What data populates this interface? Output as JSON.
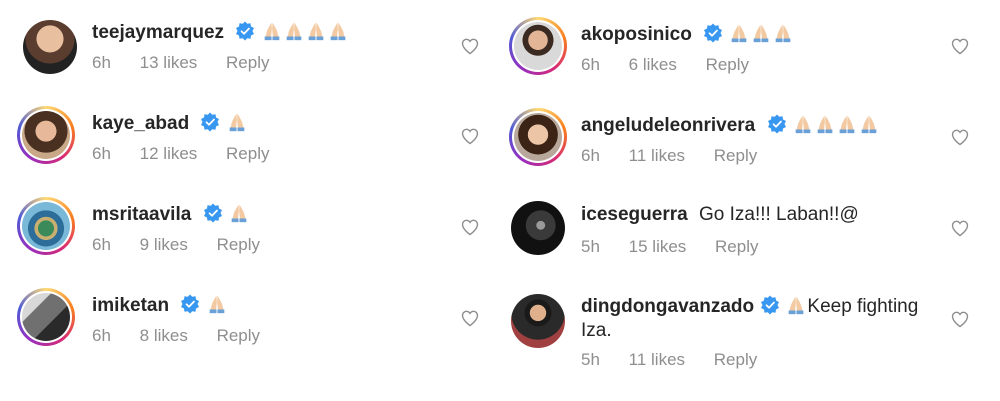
{
  "left_column": [
    {
      "username": "teejaymarquez",
      "text": "",
      "emoji_count": 4,
      "time": "6h",
      "likes": "13 likes",
      "reply": "Reply"
    },
    {
      "username": "kaye_abad",
      "text": "",
      "emoji_count": 1,
      "time": "6h",
      "likes": "12 likes",
      "reply": "Reply"
    },
    {
      "username": "msritaavila",
      "text": "",
      "emoji_count": 1,
      "time": "6h",
      "likes": "9 likes",
      "reply": "Reply"
    },
    {
      "username": "imiketan",
      "text": "",
      "emoji_count": 1,
      "time": "6h",
      "likes": "8 likes",
      "reply": "Reply"
    }
  ],
  "right_column": [
    {
      "username": "akoposinico",
      "text": "",
      "emoji_count": 3,
      "time": "6h",
      "likes": "6 likes",
      "reply": "Reply"
    },
    {
      "username": "angeludeleonrivera",
      "text": "",
      "emoji_count": 4,
      "time": "6h",
      "likes": "11 likes",
      "reply": "Reply"
    },
    {
      "username": "iceseguerra",
      "text": "Go Iza!!! Laban!!@",
      "emoji_count": 0,
      "time": "5h",
      "likes": "15 likes",
      "reply": "Reply"
    },
    {
      "username": "dingdongavanzado",
      "text": "Keep fighting Iza.",
      "emoji_count": 1,
      "time": "5h",
      "likes": "11 likes",
      "reply": "Reply"
    }
  ],
  "colors": {
    "username": "#262626",
    "meta": "#8e8e8e",
    "verified": "#3897f0",
    "emoji_skin": "#f2c9a0",
    "emoji_cuff": "#6aa0d8"
  }
}
